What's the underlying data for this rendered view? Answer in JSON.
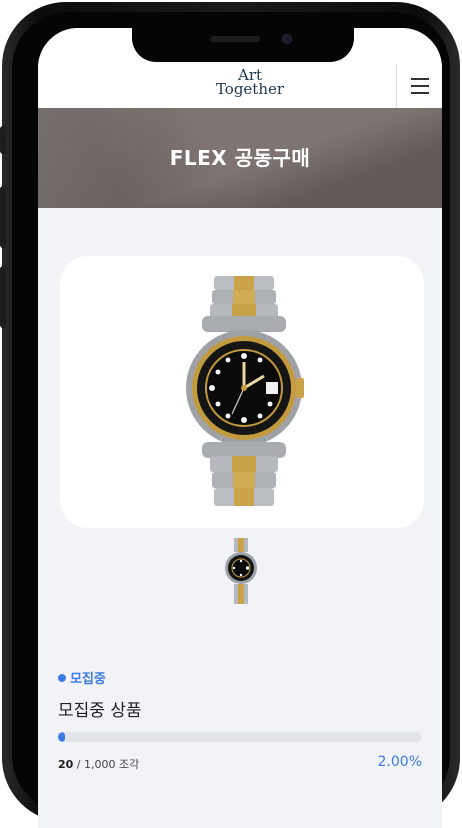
{
  "header": {
    "logo_line1": "Art",
    "logo_line2": "Together",
    "menu_icon": "hamburger-menu-icon"
  },
  "banner": {
    "title": "FLEX 공동구매"
  },
  "product": {
    "main_image_alt": "wristwatch-image",
    "thumbnail_alt": "wristwatch-thumbnail",
    "status": "모집중",
    "name": "모집중 상품",
    "progress_fraction": 0.02,
    "sold": "20",
    "separator": " / ",
    "total": "1,000",
    "unit": " 조각",
    "percent": "2.00%"
  },
  "colors": {
    "accent": "#3c7be6",
    "logo": "#1f3556",
    "banner": "#6f6462",
    "background": "#f1f3f6"
  }
}
